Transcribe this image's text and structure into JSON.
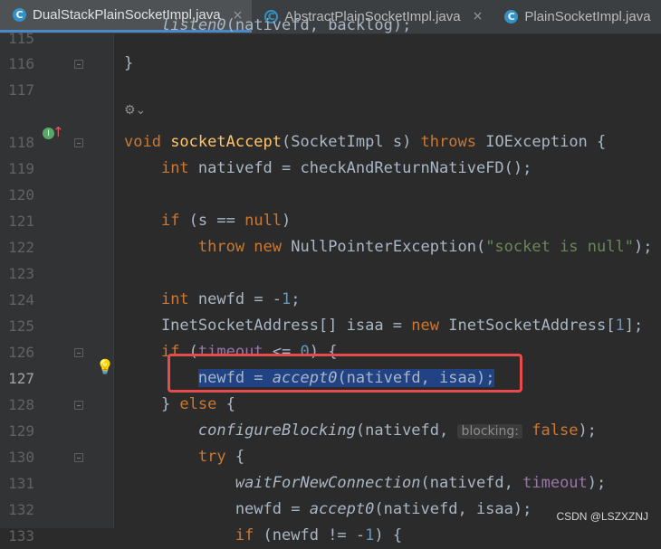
{
  "tabs": [
    {
      "label": "DualStackPlainSocketImpl.java",
      "icon": "C",
      "active": true,
      "close": "×"
    },
    {
      "label": "AbstractPlainSocketImpl.java",
      "icon": "C",
      "active": false,
      "close": "×"
    },
    {
      "label": "PlainSocketImpl.java",
      "icon": "C",
      "active": false
    }
  ],
  "editor": {
    "line_numbers": [
      "115",
      "116",
      "117",
      "118",
      "119",
      "120",
      "121",
      "122",
      "123",
      "124",
      "125",
      "126",
      "127",
      "128",
      "129",
      "130",
      "131",
      "132",
      "133"
    ],
    "current_line": "127",
    "hint_label": "blocking:",
    "ann_icon": "⚙︎⌄",
    "impl_icon": "I"
  },
  "watermark": "CSDN @LSZXZNJ",
  "colors": {
    "keyword": "#cc7832",
    "function": "#ffc66d",
    "number": "#6897bb",
    "string": "#6a8759",
    "field": "#9876aa",
    "selection": "#214283",
    "highlight_box": "#e74c4c"
  }
}
